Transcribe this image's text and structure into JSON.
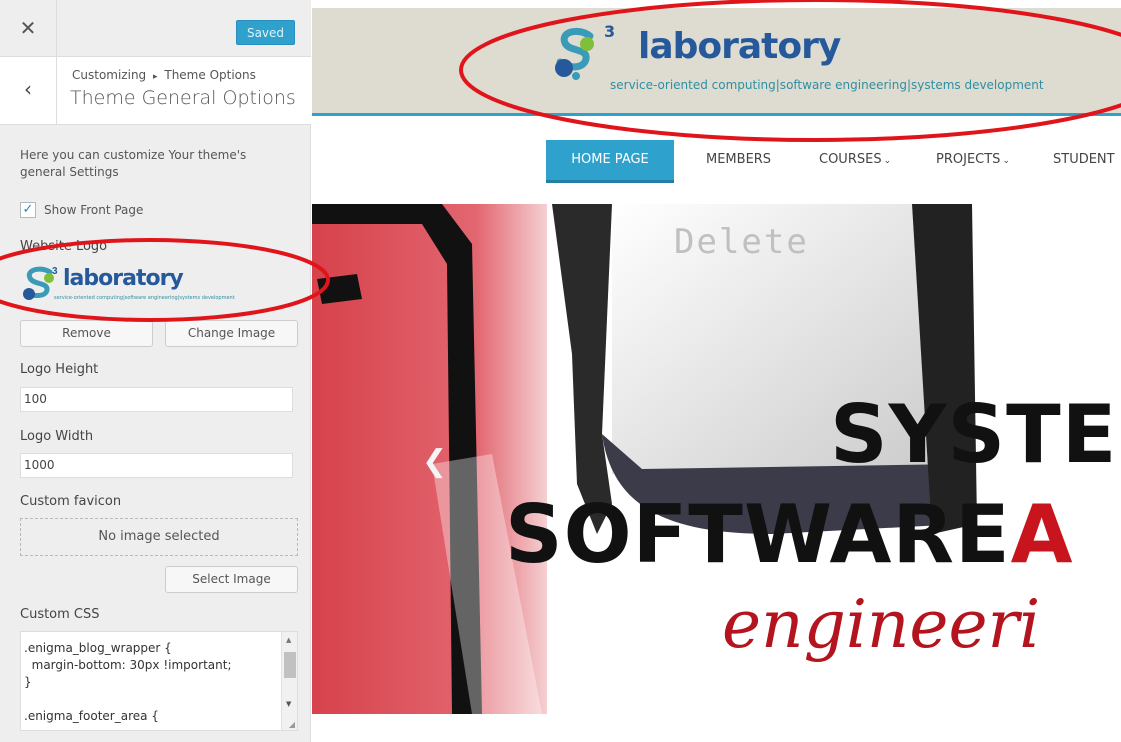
{
  "colors": {
    "accent": "#2ea2cc",
    "brand_blue": "#25599c",
    "annotation_red": "#e0151b",
    "hero_red": "#c8141c"
  },
  "panel": {
    "close_icon": "close-icon",
    "saved_label": "Saved",
    "back_icon": "chevron-left-icon",
    "breadcrumb_parent": "Customizing",
    "breadcrumb_separator": "▸",
    "breadcrumb_child": "Theme Options",
    "section_title": "Theme General Options",
    "description": "Here you can customize Your theme's general Settings",
    "show_front_page": {
      "label": "Show Front Page",
      "checked": true
    },
    "website_logo": {
      "title": "Website Logo",
      "logo_word": "laboratory",
      "logo_tagline": "service-oriented computing|software engineering|systems development",
      "remove_label": "Remove",
      "change_label": "Change Image"
    },
    "logo_height": {
      "title": "Logo Height",
      "value": "100"
    },
    "logo_width": {
      "title": "Logo Width",
      "value": "1000"
    },
    "custom_favicon": {
      "title": "Custom favicon",
      "empty_text": "No image selected",
      "select_label": "Select Image"
    },
    "custom_css": {
      "title": "Custom CSS",
      "value": ".enigma_blog_wrapper {\n  margin-bottom: 30px !important;\n}\n\n.enigma_footer_area {"
    }
  },
  "preview": {
    "header": {
      "logo_superscript": "3",
      "logo_word": "laboratory",
      "logo_tagline": "service-oriented computing|software engineering|systems development"
    },
    "nav": {
      "items": [
        {
          "label": "HOME PAGE",
          "active": true,
          "dropdown": false
        },
        {
          "label": "MEMBERS",
          "active": false,
          "dropdown": false
        },
        {
          "label": "COURSES",
          "active": false,
          "dropdown": true
        },
        {
          "label": "PROJECTS",
          "active": false,
          "dropdown": true
        },
        {
          "label": "STUDENT",
          "active": false,
          "dropdown": false
        }
      ],
      "dropdown_icon": "chevron-down-icon"
    },
    "slider": {
      "prev_icon": "chevron-left-icon",
      "key_text": "Delete",
      "line1": "SYSTE",
      "line2_main": "SOFTWARE",
      "line2_accent": "A",
      "line3": "engineeri"
    }
  }
}
